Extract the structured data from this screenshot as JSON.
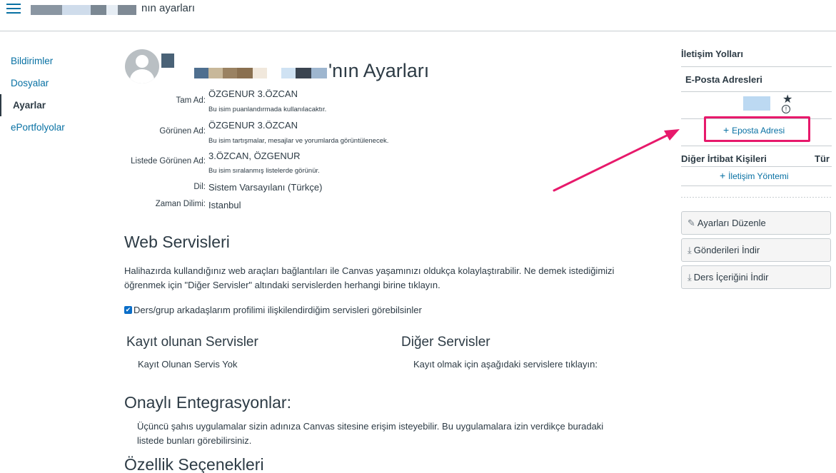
{
  "header": {
    "menu_icon": "hamburger-menu-icon",
    "crumb_suffix": "nın ayarları",
    "crumb_blur_colors": [
      "#8a96a2",
      "#7b8893",
      "#cfdceb",
      "#7f8c98",
      "#7f8a95"
    ]
  },
  "nav": {
    "items": [
      {
        "label": "Bildirimler",
        "active": false
      },
      {
        "label": "Dosyalar",
        "active": false
      },
      {
        "label": "Ayarlar",
        "active": true
      },
      {
        "label": "ePortfolyolar",
        "active": false
      }
    ]
  },
  "profile": {
    "title_suffix": "'nın Ayarları",
    "title_blur_colors": [
      "#4f6f8f",
      "#c8b89a",
      "#8a7050",
      "#f1e8dc",
      "#cfe2f3",
      "#3a4450",
      "#9eb6cf"
    ],
    "fields": [
      {
        "label": "Tam Ad:",
        "value": "ÖZGENUR 3.ÖZCAN",
        "hint": "Bu isim puanlandırmada kullanılacaktır."
      },
      {
        "label": "Görünen Ad:",
        "value": "ÖZGENUR 3.ÖZCAN",
        "hint": "Bu isim tartışmalar, mesajlar ve yorumlarda görüntülenecek."
      },
      {
        "label": "Listede Görünen Ad:",
        "value": "3.ÖZCAN, ÖZGENUR",
        "hint": "Bu isim sıralanmış listelerde görünür."
      },
      {
        "label": "Dil:",
        "value": "Sistem Varsayılanı (Türkçe)",
        "hint": ""
      },
      {
        "label": "Zaman Dilimi:",
        "value": "Istanbul",
        "hint": ""
      }
    ]
  },
  "web_services": {
    "heading": "Web Servisleri",
    "description_line1": "Halihazırda kullandığınız web araçları bağlantıları ile Canvas yaşamınızı oldukça kolaylaştırabilir. Ne demek istediğimizi",
    "description_line2": "öğrenmek için \"Diğer Servisler\" altındaki servislerden herhangi birine tıklayın.",
    "checkbox_label": "Ders/grup arkadaşlarım profilimi ilişkilendirdiğim servisleri görebilsinler",
    "checkbox_checked": true,
    "registered_heading": "Kayıt olunan Servisler",
    "registered_empty": "Kayıt Olunan Servis Yok",
    "other_heading": "Diğer Servisler",
    "other_text": "Kayıt olmak için aşağıdaki servislere tıklayın:"
  },
  "integrations": {
    "heading": "Onaylı Entegrasyonlar:",
    "text_line1": "Üçüncü şahıs uygulamalar sizin adınıza Canvas sitesine erişim isteyebilir. Bu uygulamalara izin verdikçe buradaki",
    "text_line2": "listede bunları görebilirsiniz."
  },
  "features": {
    "heading": "Özellik Seçenekleri"
  },
  "sidebar": {
    "contact_heading": "İletişim Yolları",
    "email_heading": "E-Posta Adresleri",
    "email_blur_color": "#bcd9f2",
    "star_icon": "star-icon",
    "warning_icon": "warning-circle-icon",
    "add_email": "Eposta Adresi",
    "other_contacts_heading": "Diğer İrtibat Kişileri",
    "type_heading": "Tür",
    "add_contact_method": "İletişim Yöntemi",
    "buttons": [
      {
        "label": "Ayarları Düzenle",
        "icon": "pencil-icon"
      },
      {
        "label": "Gönderileri İndir",
        "icon": "download-icon"
      },
      {
        "label": "Ders İçeriğini İndir",
        "icon": "download-icon"
      }
    ]
  },
  "annotation": {
    "highlight_color": "#e7196b"
  }
}
